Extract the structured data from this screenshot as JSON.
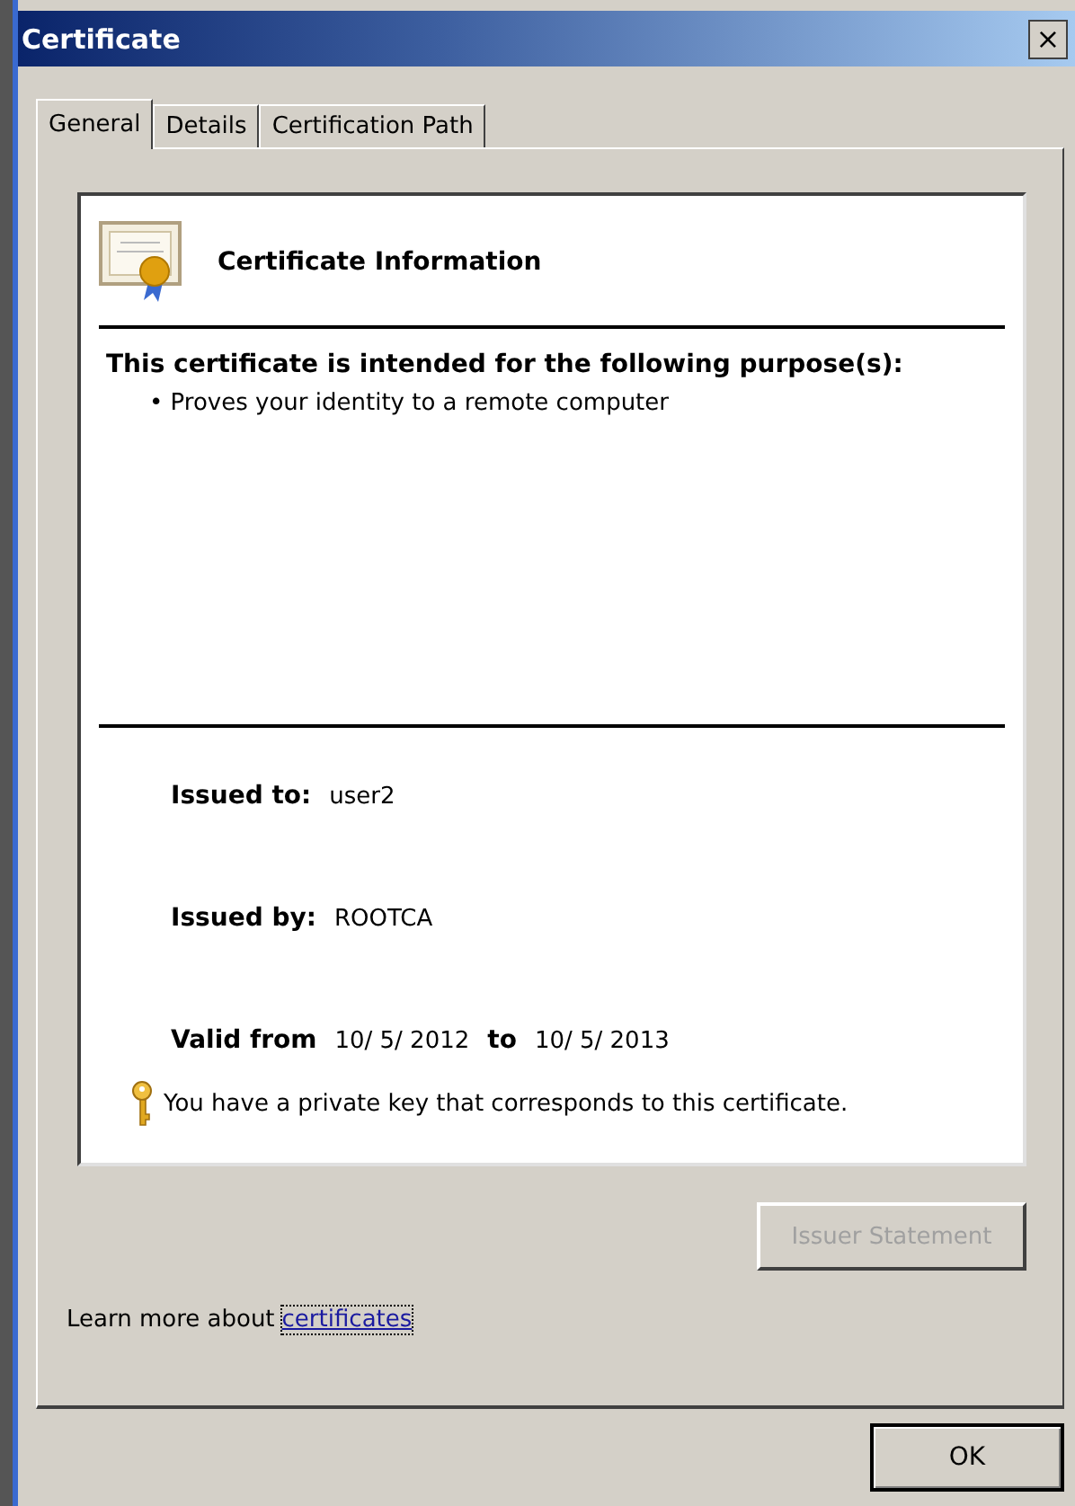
{
  "window": {
    "title": "Certificate",
    "close": "×"
  },
  "tabs": [
    {
      "label": "General",
      "selected": true
    },
    {
      "label": "Details",
      "selected": false
    },
    {
      "label": "Certification Path",
      "selected": false
    }
  ],
  "info": {
    "title": "Certificate Information",
    "purpose_heading": "This certificate is intended for the following purpose(s):",
    "purposes": [
      "• Proves your identity to a remote computer"
    ],
    "issued_to": {
      "label": "Issued to:",
      "value": "user2"
    },
    "issued_by": {
      "label": "Issued by:",
      "value": "ROOTCA"
    },
    "validity": {
      "from_label": "Valid from",
      "from": "10/ 5/ 2012",
      "to_label": "to",
      "to": "10/ 5/ 2013"
    },
    "key_note": "You have a private key that corresponds to this certificate."
  },
  "issuer_statement": {
    "label": "Issuer Statement",
    "disabled": true
  },
  "learn_more": {
    "text": "Learn more about",
    "link": "certificates"
  },
  "buttons": [
    {
      "label": "OK"
    }
  ]
}
